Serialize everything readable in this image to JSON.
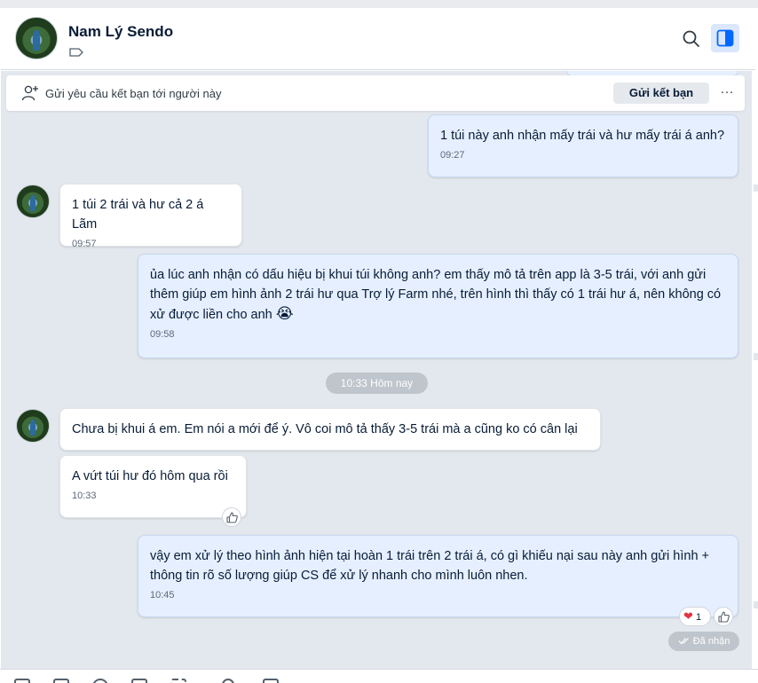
{
  "header": {
    "contact_name": "Nam Lý Sendo"
  },
  "friend_request": {
    "text": "Gửi yêu cầu kết bạn tới người này",
    "button_label": "Gửi kết bạn",
    "more_label": "···"
  },
  "messages": [
    {
      "text": "1 túi này anh nhận mấy trái và hư mấy trái á anh?",
      "time": "09:27"
    },
    {
      "text": "1 túi 2 trái và hư cả 2 á Lãm",
      "time": "09:57"
    },
    {
      "text": "ủa lúc anh nhận có dấu hiệu bị khui túi không anh? em thấy mô tả trên app là 3-5 trái, với anh gửi thêm giúp em hình ảnh 2 trái hư qua Trợ lý Farm nhé, trên hình thì thấy có 1 trái hư á, nên không có xử được liền cho anh",
      "emoji": "😭",
      "time": "09:58"
    },
    {
      "text": "Chưa bị khui á em. Em nói a mới để ý. Vô coi mô tả thấy 3-5 trái mà a cũng ko có cân lại"
    },
    {
      "text": "A vứt túi hư đó hôm qua rồi",
      "time": "10:33"
    },
    {
      "text": "vậy em xử lý theo hình ảnh hiện tại hoàn 1 trái trên 2 trái á, có gì khiếu nại sau này anh gửi hình + thông tin rõ số lượng giúp CS để xử lý nhanh cho mình luôn nhen.",
      "time": "10:45"
    }
  ],
  "day_separator": "10:33 Hôm nay",
  "reaction": {
    "count": "1"
  },
  "status": "Đã nhận",
  "colors": {
    "outgoing_bubble": "#e5efff",
    "incoming_bubble": "#ffffff",
    "chat_background": "#e3e8ee",
    "accent": "#0068ff",
    "heart": "#e3343f"
  },
  "icons": [
    "search-icon",
    "sidebar-toggle-icon",
    "tag-icon",
    "add-friend-icon",
    "like-icon",
    "heart-icon",
    "double-check-icon"
  ]
}
